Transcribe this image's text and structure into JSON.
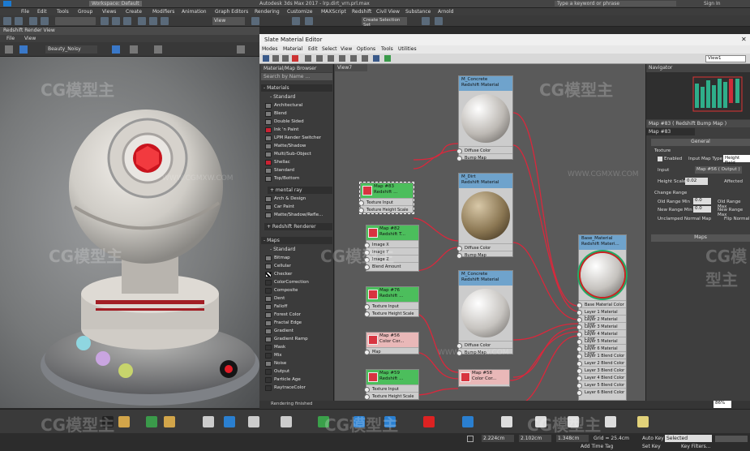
{
  "maxbar": {
    "workspace": "Workspace: Default",
    "title": "Autodesk 3ds Max 2017 - lrp.dirt_vrn.prl.max",
    "search": "Type a keyword or phrase",
    "signin": "Sign In"
  },
  "maxmenu": [
    "File",
    "Edit",
    "Tools",
    "Group",
    "Views",
    "Create",
    "Modifiers",
    "Animation",
    "Graph Editors",
    "Rendering",
    "Customize",
    "MAXScript",
    "Redshift",
    "Civil View",
    "Substance",
    "Arnold",
    "GMG"
  ],
  "maxtools": {
    "viewport": "View",
    "selection_set": "Create Selection Set"
  },
  "render_view": {
    "title": "Redshift Render View",
    "menu": [
      "File",
      "View"
    ],
    "aov": "Beauty_Noisy"
  },
  "slate": {
    "title": "Slate Material Editor",
    "menu": [
      "Modes",
      "Material",
      "Edit",
      "Select",
      "View",
      "Options",
      "Tools",
      "Utilities"
    ],
    "view_select": "View1",
    "browser": {
      "title": "Material/Map Browser",
      "search": "Search by Name ...",
      "materials_hdr": "- Materials",
      "standard_hdr": "- Standard",
      "materials": [
        "Architectural",
        "Blend",
        "Double Sided",
        "Ink 'n Paint",
        "LPM Render Switcher",
        "Matte/Shadow",
        "Multi/Sub-Object",
        "Shellac",
        "Standard",
        "Top/Bottom"
      ],
      "mental_hdr": "+ mental ray",
      "mental": [
        "Arch & Design",
        "Car Paint",
        "Matte/Shadow/Refle..."
      ],
      "redshift_hdr": "+ Redshift Renderer",
      "maps_hdr": "- Maps",
      "maps_std_hdr": "- Standard",
      "maps": [
        "Bitmap",
        "Cellular",
        "Checker",
        "ColorCorrection",
        "Composite",
        "Dent",
        "Falloff",
        "Forest Color",
        "Fractal Edge",
        "Gradient",
        "Gradient Ramp",
        "Mask",
        "Mix",
        "Noise",
        "Output",
        "Particle Age",
        "RaytraceColor"
      ]
    },
    "view_tab": "View7",
    "nodes": {
      "map83": {
        "title": "Map #83",
        "sub": "Redshift ...",
        "ports": [
          "Texture Input",
          "Texture Height Scale"
        ]
      },
      "map82": {
        "title": "Map #82",
        "sub": "Redshift T...",
        "ports": [
          "Image X",
          "Image Y",
          "Image Z",
          "Blend Amount"
        ]
      },
      "map76": {
        "title": "Map #76",
        "sub": "Redshift ...",
        "ports": [
          "Texture Input",
          "Texture Height Scale"
        ]
      },
      "map56": {
        "title": "Map #56",
        "sub": "Color Cor...",
        "ports": [
          "Map"
        ]
      },
      "map59": {
        "title": "Map #59",
        "sub": "Redshift ...",
        "ports": [
          "Texture Input",
          "Texture Height Scale"
        ]
      },
      "map68": {
        "title": "Map #68",
        "sub": "Redshift ..."
      },
      "map58": {
        "title": "Map #58",
        "sub": "Color Cor..."
      },
      "mconcrete1": {
        "title": "M_Concrete",
        "sub": "Redshift Material",
        "ports": [
          "Diffuse Color",
          "Bump Map"
        ]
      },
      "mdirt": {
        "title": "M_Dirt",
        "sub": "Redshift Material",
        "ports": [
          "Diffuse Color",
          "Bump Map"
        ]
      },
      "mconcrete2": {
        "title": "M_Concrete",
        "sub": "Redshift Material",
        "ports": [
          "Diffuse Color",
          "Bump Map"
        ]
      },
      "base": {
        "title": "Base_Material",
        "sub": "Redshift Materi...",
        "ports": [
          "Base Material Color",
          "Layer 1 Material Color",
          "Layer 2 Material Color",
          "Layer 3 Material Color",
          "Layer 4 Material Color",
          "Layer 5 Material Color",
          "Layer 6 Material Color",
          "Layer 1 Blend Color",
          "Layer 2 Blend Color",
          "Layer 3 Blend Color",
          "Layer 4 Blend Color",
          "Layer 5 Blend Color",
          "Layer 6 Blend Color",
          "Ior Connection"
        ]
      }
    },
    "navigator": "Navigator",
    "params": {
      "map_name": "Map #83  ( Redshift Bump Map )",
      "map_id": "Map #83",
      "general": "General",
      "texture": "Texture",
      "enabled": "Enabled",
      "input_map_type": "Input Map Type",
      "height_field": "Height Field",
      "input": "Input",
      "input_value": "Map #56 ( Output )",
      "height_scale": "Height Scale",
      "height_scale_val": "0.02",
      "affected": "Affected",
      "change_range": "Change Range",
      "old_min": "Old Range Min",
      "old_min_val": "0.0",
      "old_max": "Old Range Max",
      "new_min": "New Range Min",
      "new_min_val": "0.0",
      "new_max": "New Range Max",
      "unclamped": "Unclamped Normal Map",
      "flip": "Flip Normal",
      "maps_hdr": "Maps"
    },
    "status": "Rendering finished",
    "zoom": "86%"
  },
  "bottom": {
    "x": "2.224cm",
    "y": "2.102cm",
    "z": "1.348cm",
    "grid": "Grid = 25.4cm",
    "autokey": "Auto Key",
    "selected": "Selected",
    "setkey": "Set Key",
    "keyfilters": "Key Filters...",
    "addtime": "Add Time Tag"
  },
  "watermarks": [
    "CG模型主",
    "CG模型主",
    "CG模型主",
    "CG模型主",
    "CG模型主",
    "CG模型主",
    "CG模型主",
    "CG模型主"
  ],
  "watermark_urls": [
    "WWW.CGMXW.COM",
    "WWW.CGMXW.COM",
    "WWW.CGMXW.COM"
  ]
}
